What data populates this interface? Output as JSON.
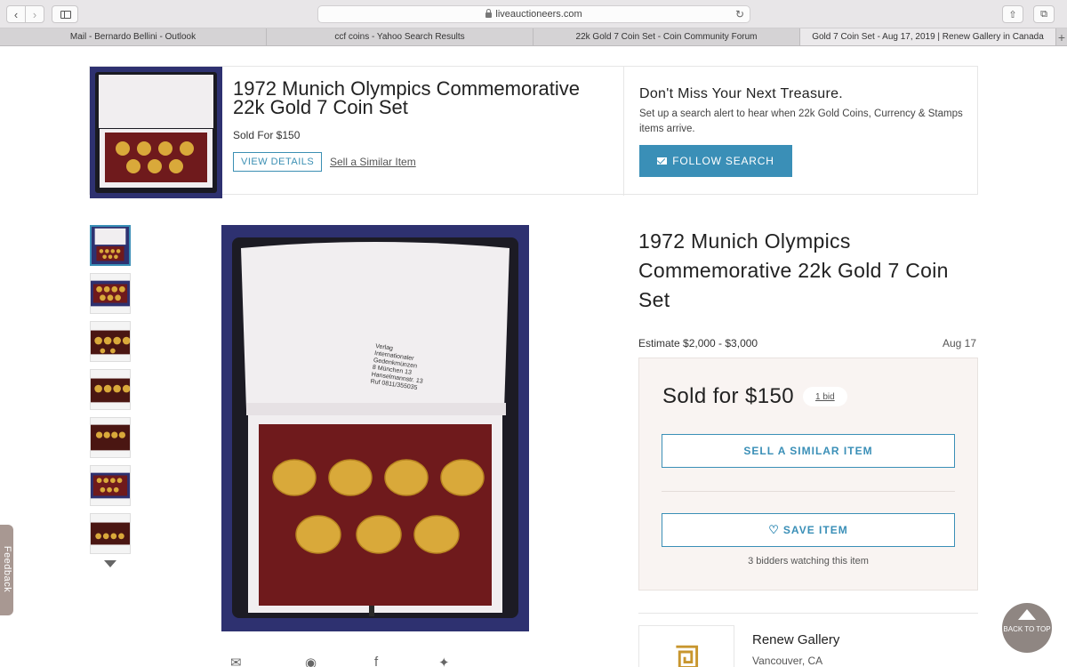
{
  "browser": {
    "url": "liveauctioneers.com",
    "tabs": [
      {
        "label": "Mail - Bernardo Bellini - Outlook"
      },
      {
        "label": "ccf coins - Yahoo Search Results"
      },
      {
        "label": "22k Gold 7 Coin Set - Coin Community Forum"
      },
      {
        "label": "Gold 7 Coin Set - Aug 17, 2019 | Renew Gallery in Canada"
      }
    ],
    "new_tab": "+"
  },
  "banner": {
    "title": "1972 Munich Olympics Commemorative 22k Gold 7 Coin Set",
    "sold": "Sold For $150",
    "view_details": "VIEW DETAILS",
    "sell_similar": "Sell a Similar Item",
    "treasure_title": "Don't Miss Your Next Treasure.",
    "treasure_text": "Set up a search alert to hear when 22k Gold Coins, Currency & Stamps items arrive.",
    "follow_search": "FOLLOW SEARCH"
  },
  "image": {
    "box_text": "Verlag\nInternationaler\nGedenkmünzen\n8 München 13\nHanselmannstr. 13\nRuf 0811/355035"
  },
  "lot": {
    "title": "1972 Munich Olympics Commemorative 22k Gold 7 Coin Set",
    "estimate": "Estimate $2,000 - $3,000",
    "date": "Aug 17",
    "sold_for": "Sold for $150",
    "bids": "1 bid",
    "sell_similar": "SELL A SIMILAR ITEM",
    "save_item": "SAVE ITEM",
    "watching": "3 bidders watching this item"
  },
  "gallery": {
    "name": "Renew Gallery",
    "location": "Vancouver, CA"
  },
  "feedback": "Feedback",
  "back_to_top": "BACK TO TOP",
  "colors": {
    "accent": "#3a8fb7",
    "box_blue": "#2e3170",
    "velvet": "#6f1a1c",
    "gold": "#d9a93a",
    "lining": "#f1eef0"
  }
}
